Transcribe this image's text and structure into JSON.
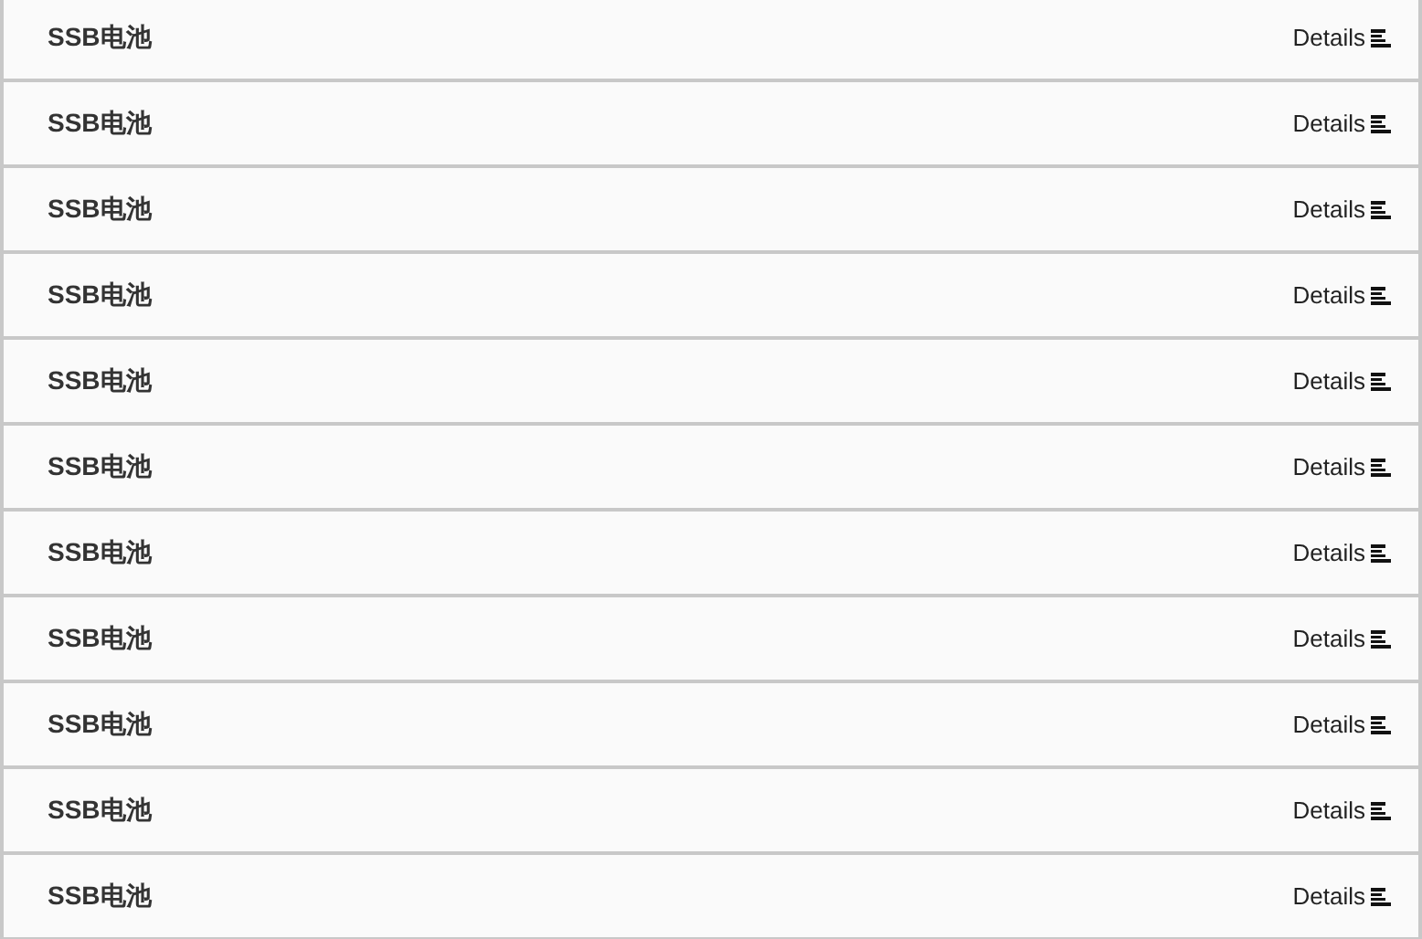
{
  "rows": [
    {
      "title": "SSB电池",
      "action": "Details"
    },
    {
      "title": "SSB电池",
      "action": "Details"
    },
    {
      "title": "SSB电池",
      "action": "Details"
    },
    {
      "title": "SSB电池",
      "action": "Details"
    },
    {
      "title": "SSB电池",
      "action": "Details"
    },
    {
      "title": "SSB电池",
      "action": "Details"
    },
    {
      "title": "SSB电池",
      "action": "Details"
    },
    {
      "title": "SSB电池",
      "action": "Details"
    },
    {
      "title": "SSB电池",
      "action": "Details"
    },
    {
      "title": "SSB电池",
      "action": "Details"
    },
    {
      "title": "SSB电池",
      "action": "Details"
    }
  ]
}
